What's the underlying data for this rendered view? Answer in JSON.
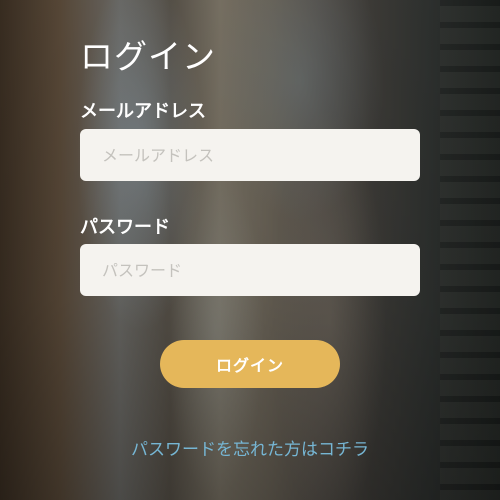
{
  "login": {
    "title": "ログイン",
    "email": {
      "label": "メールアドレス",
      "placeholder": "メールアドレス",
      "value": ""
    },
    "password": {
      "label": "パスワード",
      "placeholder": "パスワード",
      "value": ""
    },
    "submit_label": "ログイン",
    "forgot_link": "パスワードを忘れた方はコチラ"
  },
  "colors": {
    "button": "#e5b75a",
    "link": "#76b6d4",
    "input_background": "#f5f3ef",
    "text": "#ffffff"
  }
}
